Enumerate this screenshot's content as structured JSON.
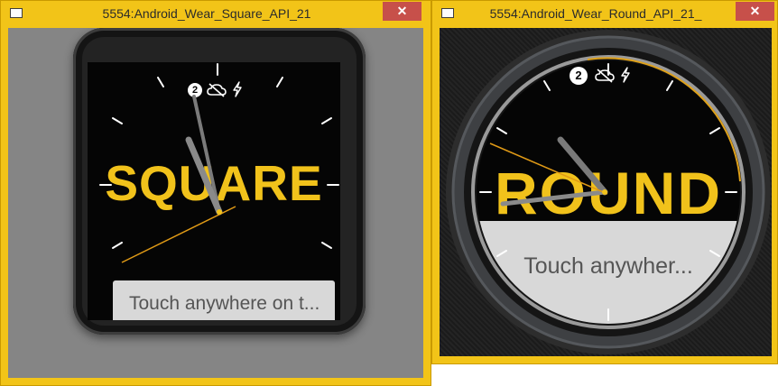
{
  "colors": {
    "window_frame": "#f2c418",
    "close_button": "#c7504a",
    "watch_accent": "#f1c21b",
    "second_hand": "#e09a16",
    "card_bg": "#d8d8d8",
    "card_text": "#555555"
  },
  "square_window": {
    "title": "5554:Android_Wear_Square_API_21",
    "close_glyph": "✕",
    "face": {
      "notification_count": "2",
      "status_icons": [
        "cloud-off-icon",
        "lightning-bolt-icon"
      ],
      "label": "SQUARE",
      "card_text": "Touch anywhere on t..."
    }
  },
  "round_window": {
    "title": "5554:Android_Wear_Round_API_21_",
    "close_glyph": "✕",
    "face": {
      "notification_count": "2",
      "status_icons": [
        "cloud-off-icon",
        "lightning-bolt-icon"
      ],
      "label": "ROUND",
      "card_text": "Touch anywher..."
    }
  }
}
